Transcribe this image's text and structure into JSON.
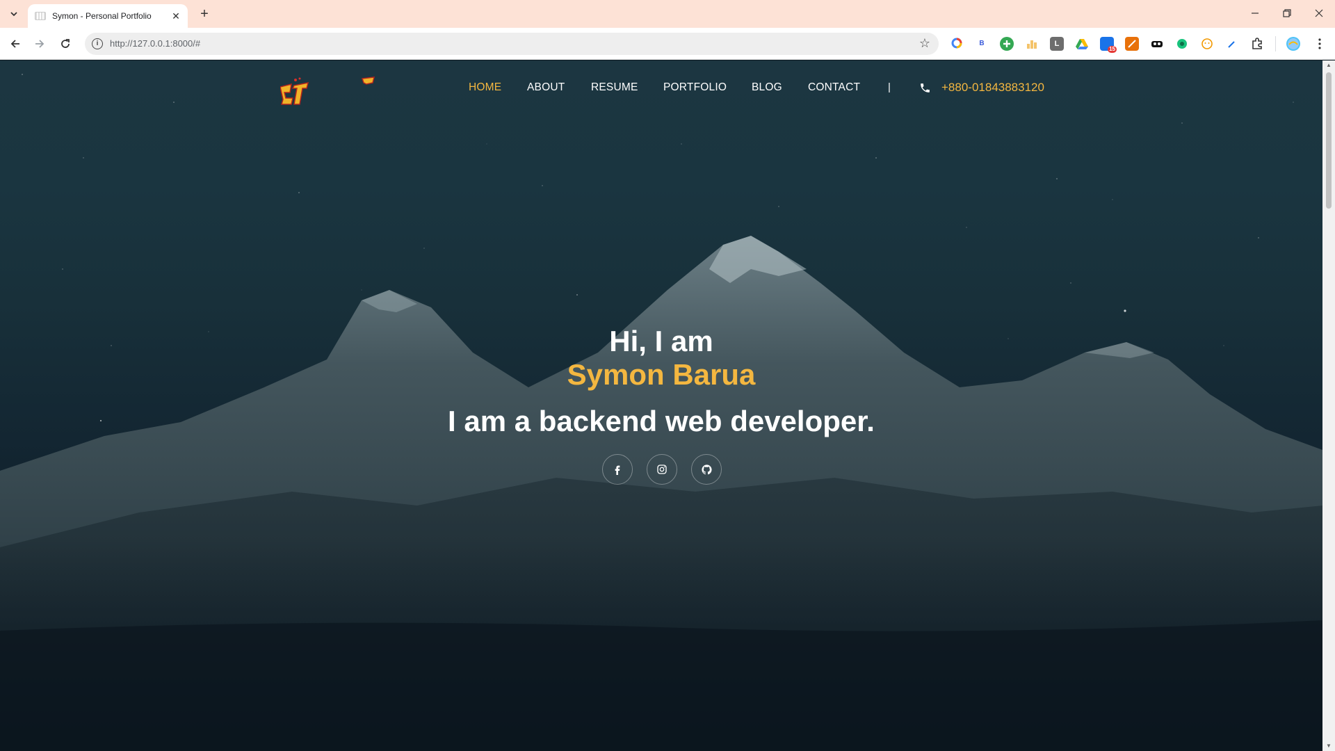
{
  "browser": {
    "tab_title": "Symon - Personal Portfolio",
    "url": "http://127.0.0.1:8000/#",
    "new_tab_symbol": "+",
    "close_symbol": "✕",
    "ext_badge_count": "15",
    "ext_letters": {
      "b": "B",
      "l": "L"
    }
  },
  "nav": {
    "items": [
      {
        "label": "HOME",
        "active": true
      },
      {
        "label": "ABOUT",
        "active": false
      },
      {
        "label": "RESUME",
        "active": false
      },
      {
        "label": "PORTFOLIO",
        "active": false
      },
      {
        "label": "BLOG",
        "active": false
      },
      {
        "label": "CONTACT",
        "active": false
      }
    ],
    "separator": "|",
    "phone": "+880-01843883120"
  },
  "hero": {
    "greeting": "Hi, I am",
    "name": "Symon Barua",
    "role": "I am a backend web developer."
  },
  "social": [
    "facebook-icon",
    "instagram-icon",
    "github-icon"
  ],
  "colors": {
    "accent": "#f4b740",
    "tabbar": "#fde2d6",
    "background": "#1a3540"
  }
}
